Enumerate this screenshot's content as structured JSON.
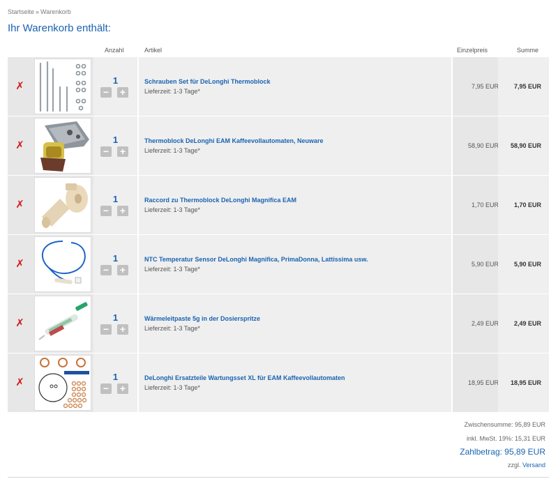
{
  "breadcrumb": {
    "home": "Startseite",
    "separator": "»",
    "current": "Warenkorb"
  },
  "title": "Ihr Warenkorb enthält:",
  "columns": {
    "quantity": "Anzahl",
    "article": "Artikel",
    "unit_price": "Einzelpreis",
    "total": "Summe"
  },
  "remove_symbol": "✗",
  "qty_minus": "−",
  "qty_plus": "+",
  "colors": {
    "row_a": "#e7e7e7",
    "row_b": "#efefef",
    "link": "#1a63b0",
    "remove": "#d21a1a"
  },
  "items": [
    {
      "image": "screws-set-icon",
      "qty": "1",
      "title": "Schrauben Set für DeLonghi Thermoblock",
      "delivery": "Lieferzeit: 1-3 Tage*",
      "unit_price": "7,95 EUR",
      "sum": "7,95 EUR"
    },
    {
      "image": "thermoblock-icon",
      "qty": "1",
      "title": "Thermoblock DeLonghi EAM Kaffeevollautomaten, Neuware",
      "delivery": "Lieferzeit: 1-3 Tage*",
      "unit_price": "58,90 EUR",
      "sum": "58,90 EUR"
    },
    {
      "image": "raccord-icon",
      "qty": "1",
      "title": "Raccord zu Thermoblock DeLonghi Magnifica EAM",
      "delivery": "Lieferzeit: 1-3 Tage*",
      "unit_price": "1,70 EUR",
      "sum": "1,70 EUR"
    },
    {
      "image": "ntc-sensor-icon",
      "qty": "1",
      "title": "NTC Temperatur Sensor DeLonghi Magnifica, PrimaDonna, Lattissima usw.",
      "delivery": "Lieferzeit: 1-3 Tage*",
      "unit_price": "5,90 EUR",
      "sum": "5,90 EUR"
    },
    {
      "image": "thermal-paste-syringe-icon",
      "qty": "1",
      "title": "Wärmeleitpaste 5g in der Dosierspritze",
      "delivery": "Lieferzeit: 1-3 Tage*",
      "unit_price": "2,49 EUR",
      "sum": "2,49 EUR"
    },
    {
      "image": "maintenance-kit-icon",
      "qty": "1",
      "title": "DeLonghi Ersatzteile Wartungsset XL für EAM Kaffeevollautomaten",
      "delivery": "Lieferzeit: 1-3 Tage*",
      "unit_price": "18,95 EUR",
      "sum": "18,95 EUR"
    }
  ],
  "totals": {
    "subtotal": "Zwischensumme: 95,89 EUR",
    "tax": "inkl. MwSt. 19%: 15,31 EUR",
    "payable": "Zahlbetrag: 95,89 EUR",
    "shipping_prefix": "zzgl.",
    "shipping_link": "Versand"
  }
}
